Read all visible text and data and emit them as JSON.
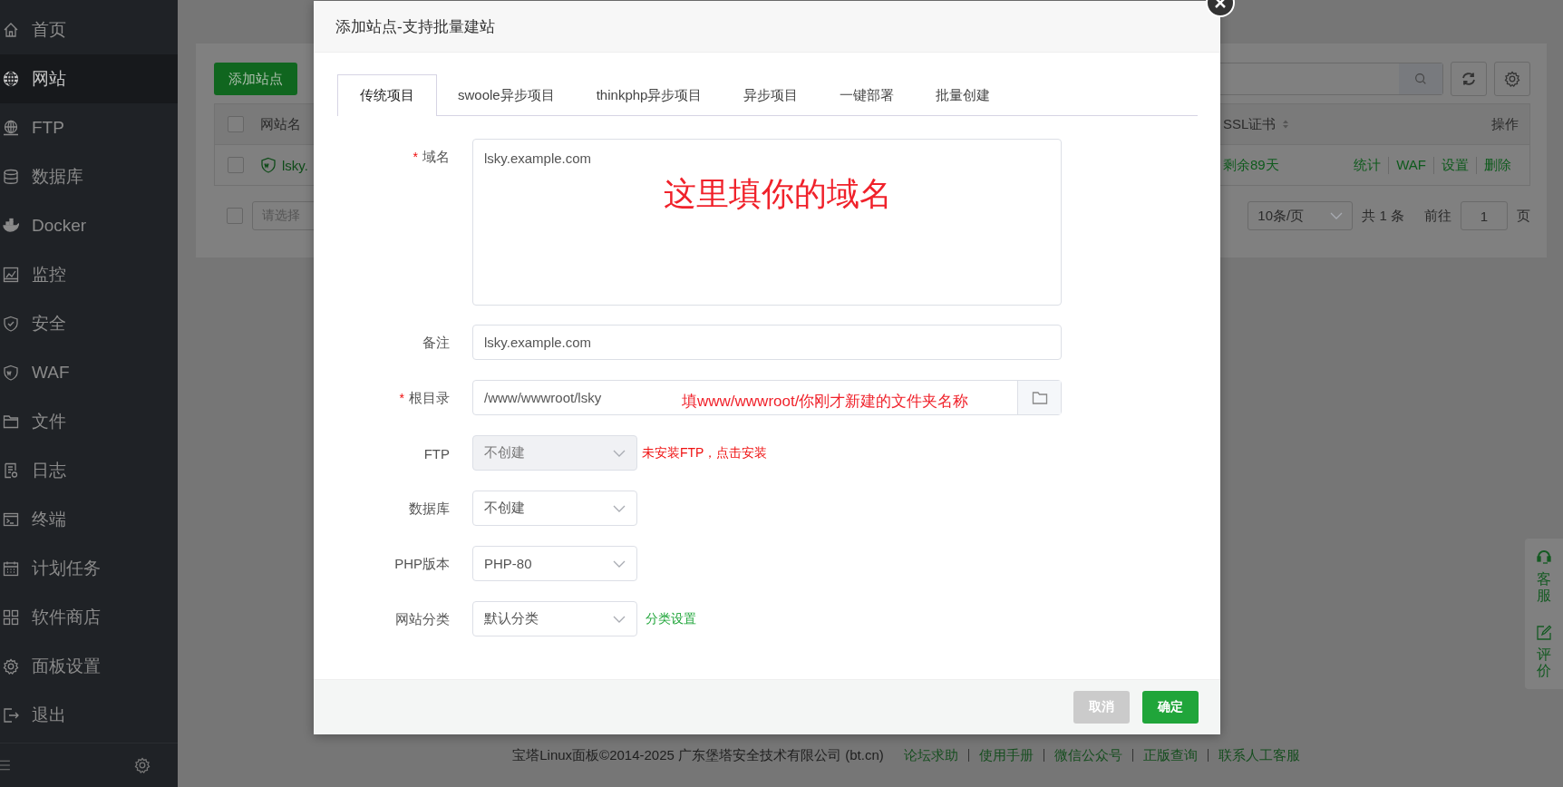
{
  "sidebar": {
    "items": [
      {
        "label": "首页",
        "selected": false
      },
      {
        "label": "网站",
        "selected": true
      },
      {
        "label": "FTP",
        "selected": false
      },
      {
        "label": "数据库",
        "selected": false
      },
      {
        "label": "Docker",
        "selected": false
      },
      {
        "label": "监控",
        "selected": false
      },
      {
        "label": "安全",
        "selected": false
      },
      {
        "label": "WAF",
        "selected": false
      },
      {
        "label": "文件",
        "selected": false
      },
      {
        "label": "日志",
        "selected": false
      },
      {
        "label": "终端",
        "selected": false
      },
      {
        "label": "计划任务",
        "selected": false
      },
      {
        "label": "软件商店",
        "selected": false
      },
      {
        "label": "面板设置",
        "selected": false
      },
      {
        "label": "退出",
        "selected": false
      }
    ]
  },
  "background_page": {
    "add_button": "添加站点",
    "table": {
      "header_checked": false,
      "columns": [
        "网站名",
        "SSL证书",
        "操作"
      ],
      "rows": [
        {
          "checked": false,
          "name": "lsky.",
          "ssl": "剩余89天",
          "actions": [
            "统计",
            "WAF",
            "设置",
            "删除"
          ]
        }
      ]
    },
    "pagination": {
      "checked": false,
      "batch_placeholder": "请选择",
      "page_size": "10条/页",
      "total": "共 1 条",
      "goto_label": "前往",
      "page": "1",
      "page_suffix": "页"
    }
  },
  "dialog": {
    "title": "添加站点-支持批量建站",
    "tabs": [
      {
        "label": "传统项目",
        "selected": true
      },
      {
        "label": "swoole异步项目",
        "selected": false
      },
      {
        "label": "thinkphp异步项目",
        "selected": false
      },
      {
        "label": "异步项目",
        "selected": false
      },
      {
        "label": "一键部署",
        "selected": false
      },
      {
        "label": "批量创建",
        "selected": false
      }
    ],
    "fields": [
      {
        "kind": "textarea",
        "label": "域名",
        "required_mark": "*",
        "value": "lsky.example.com",
        "annotation": "这里填你的域名"
      },
      {
        "kind": "input",
        "label": "备注",
        "value": "lsky.example.com"
      },
      {
        "kind": "path",
        "label": "根目录",
        "required_mark": "*",
        "value": "/www/wwwroot/lsky",
        "annotation": "填www/wwwroot/你刚才新建的文件夹名称"
      },
      {
        "kind": "select",
        "label": "FTP",
        "value": "不创建",
        "disabled": true,
        "hint": "未安装FTP，点击安装"
      },
      {
        "kind": "select",
        "label": "数据库",
        "value": "不创建",
        "disabled": false
      },
      {
        "kind": "select",
        "label": "PHP版本",
        "value": "PHP-80",
        "disabled": false
      },
      {
        "kind": "select",
        "label": "网站分类",
        "value": "默认分类",
        "disabled": false,
        "hint": "分类设置"
      }
    ],
    "buttons": [
      {
        "label": "取消",
        "kind": "cancel"
      },
      {
        "label": "确定",
        "kind": "primary"
      }
    ]
  },
  "footer": {
    "copyright": "宝塔Linux面板©2014-2025 广东堡塔安全技术有限公司 (bt.cn)",
    "links": [
      "论坛求助",
      "使用手册",
      "微信公众号",
      "正版查询",
      "联系人工客服"
    ]
  },
  "float_widget": {
    "items": [
      {
        "label": "客服"
      },
      {
        "label": "评价"
      }
    ]
  }
}
